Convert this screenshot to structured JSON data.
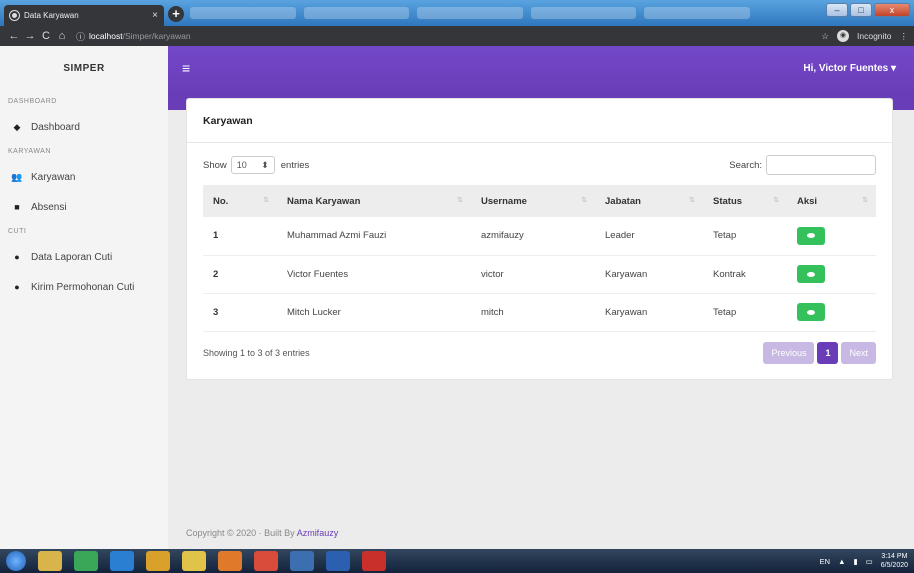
{
  "browser": {
    "tab_title": "Data Karyawan",
    "tab_close": "×",
    "new_tab": "+",
    "url_host": "localhost",
    "url_path": "/Simper/karyawan",
    "incognito_label": "Incognito",
    "win_min": "–",
    "win_max": "□",
    "win_close": "x"
  },
  "sidebar": {
    "brand": "SIMPER",
    "sections": [
      {
        "heading": "DASHBOARD",
        "items": [
          {
            "label": "Dashboard",
            "icon": "tachometer-icon"
          }
        ]
      },
      {
        "heading": "KARYAWAN",
        "items": [
          {
            "label": "Karyawan",
            "icon": "users-icon"
          },
          {
            "label": "Absensi",
            "icon": "book-icon"
          }
        ]
      },
      {
        "heading": "CUTI",
        "items": [
          {
            "label": "Data Laporan Cuti",
            "icon": "circle-icon"
          },
          {
            "label": "Kirim Permohonan Cuti",
            "icon": "circle-icon"
          }
        ]
      }
    ]
  },
  "topbar": {
    "menu_icon": "≡",
    "user_greeting": "Hi, Victor Fuentes ▾"
  },
  "card": {
    "title": "Karyawan",
    "show_label": "Show",
    "entries_value": "10",
    "entries_label": "entries",
    "search_label": "Search:",
    "columns": [
      "No.",
      "Nama Karyawan",
      "Username",
      "Jabatan",
      "Status",
      "Aksi"
    ],
    "rows": [
      {
        "no": "1",
        "nama": "Muhammad Azmi Fauzi",
        "username": "azmifauzy",
        "jabatan": "Leader",
        "status": "Tetap"
      },
      {
        "no": "2",
        "nama": "Victor Fuentes",
        "username": "victor",
        "jabatan": "Karyawan",
        "status": "Kontrak"
      },
      {
        "no": "3",
        "nama": "Mitch Lucker",
        "username": "mitch",
        "jabatan": "Karyawan",
        "status": "Tetap"
      }
    ],
    "info": "Showing 1 to 3 of 3 entries",
    "pager": {
      "previous": "Previous",
      "current": "1",
      "next": "Next"
    }
  },
  "footer": {
    "copyright": "Copyright © 2020 · Built By ",
    "author": "Azmifauzy"
  },
  "taskbar": {
    "lang": "EN",
    "time": "3:14 PM",
    "date": "6/5/2020"
  },
  "colors": {
    "accent": "#6a3db8",
    "success": "#34c15b"
  }
}
